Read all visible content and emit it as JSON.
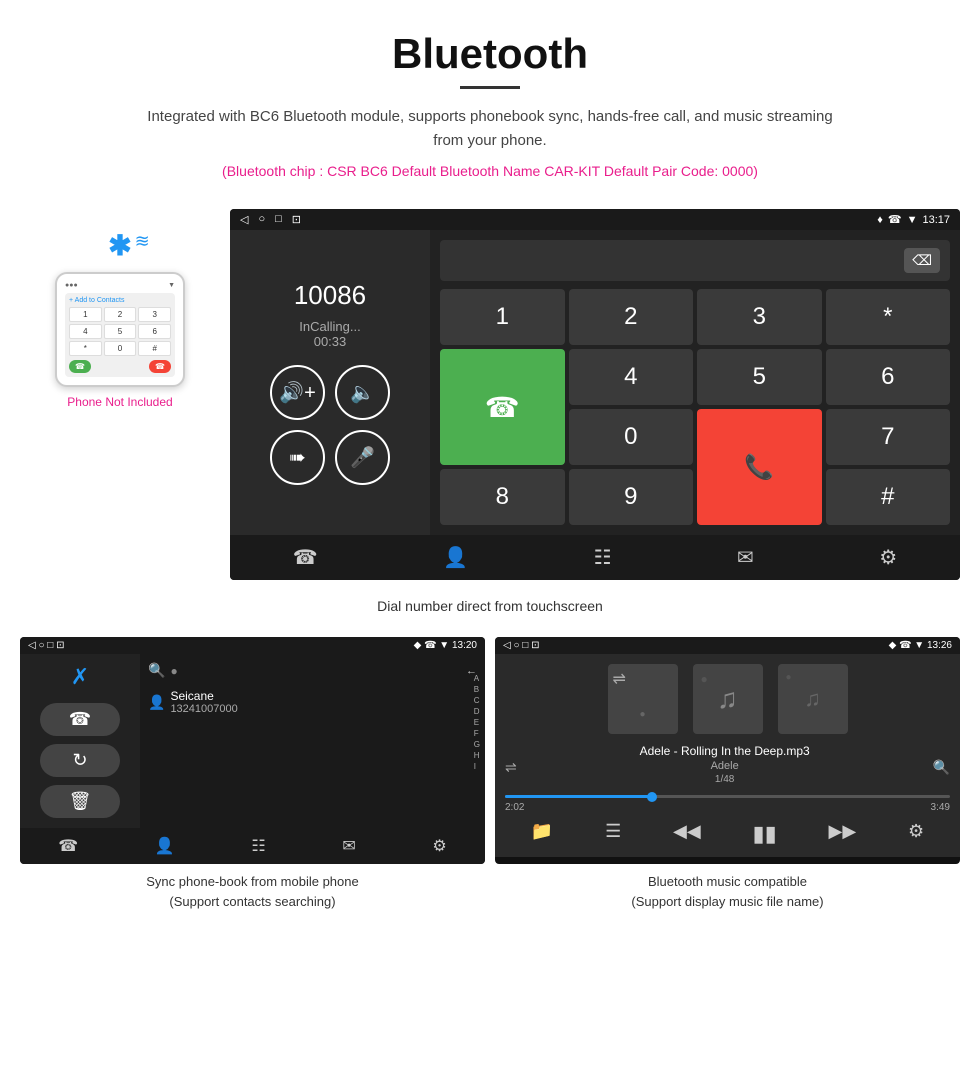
{
  "header": {
    "title": "Bluetooth",
    "description": "Integrated with BC6 Bluetooth module, supports phonebook sync, hands-free call, and music streaming from your phone.",
    "specs": "(Bluetooth chip : CSR BC6    Default Bluetooth Name CAR-KIT    Default Pair Code: 0000)"
  },
  "main_screen": {
    "status_bar": {
      "left": [
        "◁",
        "○",
        "□",
        "⊡"
      ],
      "right": "♦ ☎ ▼ 13:17"
    },
    "dial_number": "10086",
    "call_status": "InCalling...",
    "call_timer": "00:33",
    "keypad": [
      "1",
      "2",
      "3",
      "*",
      "4",
      "5",
      "6",
      "0",
      "7",
      "8",
      "9",
      "#"
    ],
    "caption": "Dial number direct from touchscreen"
  },
  "phone_side": {
    "not_included": "Phone Not Included"
  },
  "phonebook_screen": {
    "status_right": "◆ ☎ ▼ 13:20",
    "contact_name": "Seicane",
    "contact_number": "13241007000",
    "alphabet": [
      "A",
      "B",
      "C",
      "D",
      "E",
      "F",
      "G",
      "H",
      "I"
    ],
    "caption_line1": "Sync phone-book from mobile phone",
    "caption_line2": "(Support contacts searching)"
  },
  "music_screen": {
    "status_right": "◆ ☎ ▼ 13:26",
    "song_title": "Adele - Rolling In the Deep.mp3",
    "artist": "Adele",
    "track_info": "1/48",
    "time_current": "2:02",
    "time_total": "3:49",
    "caption_line1": "Bluetooth music compatible",
    "caption_line2": "(Support display music file name)"
  }
}
